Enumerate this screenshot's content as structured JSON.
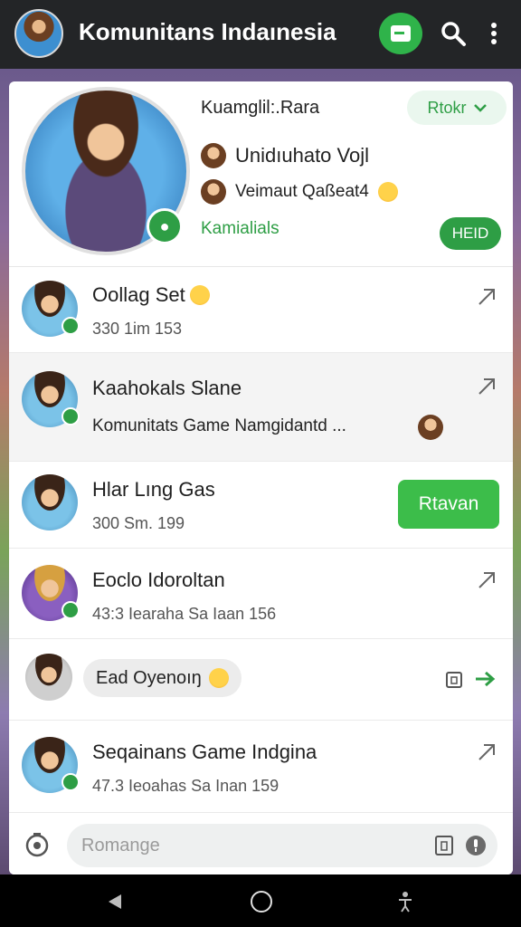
{
  "topbar": {
    "title": "Komunitans Indaınesia",
    "icons": [
      "avatar",
      "document-icon",
      "search-icon",
      "more-vert-icon"
    ]
  },
  "profile": {
    "name": "Kuamglil:.Rara",
    "follow_label": "Rtokr",
    "row1_text": "Unidıuhato Vojl",
    "row2_text": "Veimaut Qaßeat4",
    "tagline": "Kamialials",
    "held_label": "HEID",
    "accent_color": "#2e9e45"
  },
  "chats": [
    {
      "title": "Oollag Set",
      "sub": "330 1im 153"
    },
    {
      "title": "Kaahokals Slane",
      "sub": "Komunitats Game Namgidantd ..."
    },
    {
      "title": "Hlar Lıng Gas",
      "sub": "300 Sm. 199",
      "action": "Rtavan"
    },
    {
      "title": "Eoclo Idoroltan",
      "sub": "43:3 Iearaha  Sa Iaan 156"
    },
    {
      "bubble": "Ead Oyenoıŋ"
    },
    {
      "title": "Seqainans Game Indgina",
      "sub": "47.3 Ieoahas  Sa Inan 159"
    }
  ],
  "composer": {
    "placeholder": "Romange"
  }
}
